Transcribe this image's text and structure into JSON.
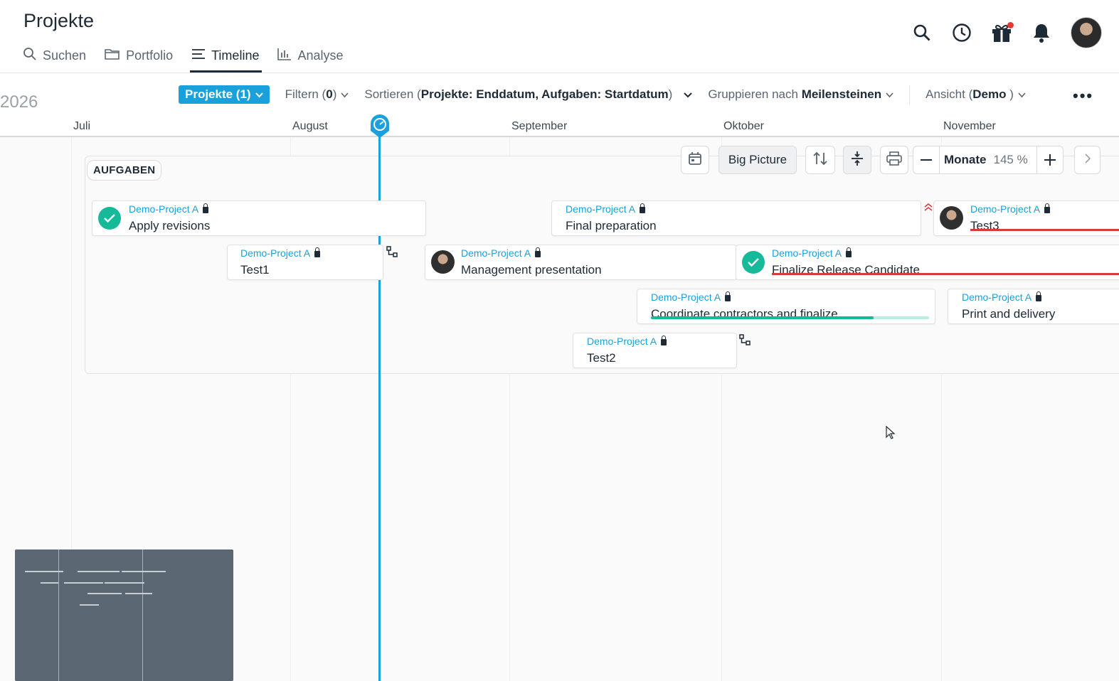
{
  "header": {
    "title": "Projekte",
    "tabs": [
      {
        "label": "Suchen",
        "icon": "search-icon"
      },
      {
        "label": "Portfolio",
        "icon": "folder-icon"
      },
      {
        "label": "Timeline",
        "icon": "list-icon",
        "active": true
      },
      {
        "label": "Analyse",
        "icon": "bar-chart-icon"
      }
    ],
    "icons": [
      "search-icon",
      "history-icon",
      "gift-icon",
      "bell-icon",
      "user-avatar"
    ]
  },
  "toolbar": {
    "year": "2026",
    "projects_label": "Projekte (1)",
    "filter_prefix": "Filtern (",
    "filter_count": "0",
    "filter_suffix": ")",
    "sort_prefix": "Sortieren (",
    "sort_value": "Projekte: Enddatum, Aufgaben: Startdatum",
    "sort_suffix": ")",
    "group_prefix": "Gruppieren nach ",
    "group_value": "Meilensteinen",
    "view_prefix": "Ansicht (",
    "view_value": "Demo",
    "view_suffix": " )",
    "more_label": "•••"
  },
  "months": [
    "Juli",
    "August",
    "September",
    "Oktober",
    "November"
  ],
  "timeline_controls": {
    "big_picture": "Big Picture",
    "zoom_unit": "Monate",
    "zoom_percent": "145 %"
  },
  "group": {
    "label": "AUFGABEN"
  },
  "tasks": [
    {
      "project": "Demo-Project A",
      "name": "Apply revisions",
      "status": "done"
    },
    {
      "project": "Demo-Project A",
      "name": "Final preparation"
    },
    {
      "project": "Demo-Project A",
      "name": "Test3",
      "assignee": "avatar",
      "overdue": true
    },
    {
      "project": "Demo-Project A",
      "name": "Test1"
    },
    {
      "project": "Demo-Project A",
      "name": "Management presentation",
      "assignee": "avatar"
    },
    {
      "project": "Demo-Project A",
      "name": "Finalize Release Candidate",
      "status": "done",
      "overdue": true
    },
    {
      "project": "Demo-Project A",
      "name": "Coordinate contractors and finalize",
      "progress": 0.8
    },
    {
      "project": "Demo-Project A",
      "name": "Print and delivery"
    },
    {
      "project": "Demo-Project A",
      "name": "Test2"
    }
  ],
  "colors": {
    "accent": "#1aa0db",
    "done": "#16b99a",
    "overdue": "#d93b3b",
    "text": "#1e2a35"
  }
}
